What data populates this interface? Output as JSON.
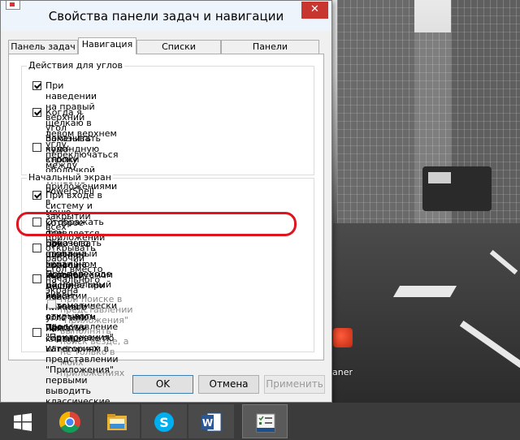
{
  "dialog": {
    "title": "Свойства панели задач и навигации",
    "close_glyph": "✕",
    "tabs": [
      "Панель задач",
      "Навигация",
      "Списки переходов",
      "Панели инструментов"
    ],
    "active_tab": "Навигация",
    "group_corners": {
      "title": "Действия для углов",
      "items": [
        {
          "label": "При наведении на правый верхний угол показывать\nчудо-кнопки",
          "checked": true
        },
        {
          "label": "Когда я щелкаю в левом верхнем углу, переключаться между\nпоследними приложениями",
          "checked": true
        },
        {
          "label": "Заменить командную строку оболочкой Windows PowerShell в\nменю, которое появляется при щелчке правой кнопкой мыши\nлевого нижнего угла или нажатии клавиш Windows+X",
          "checked": false
        }
      ]
    },
    "group_start": {
      "title": "Начальный экран",
      "items": [
        {
          "label": "При входе в систему и закрытии всех приложений открывать\nрабочий стол вместо начального экрана",
          "checked": true
        },
        {
          "label": "Отображать фон рабочего стола на начальном экране",
          "checked": false,
          "highlighted": true
        },
        {
          "label": "Показывать начальный экран на используемом дисплее при\nнажатии клавиши с логотипом Windows",
          "checked": false
        },
        {
          "label": "При переходе на начальный экран автоматически открывать\nпредставление \"Приложения\"",
          "checked": false
        },
        {
          "label": "При поиске в представлении \"Приложения\" выполнять\nпоиск везде, а не только в моих приложениях",
          "checked": false,
          "disabled": true
        },
        {
          "label": "При сортировке по категориям в представлении \"Приложения\"\nпервыми выводить классические приложения",
          "checked": false
        }
      ]
    },
    "buttons": {
      "ok": "OK",
      "cancel": "Отмена",
      "apply": "Применить"
    }
  },
  "desktop": {
    "icon_label": "aner"
  },
  "taskbar": {
    "items": [
      "start-icon",
      "chrome-icon",
      "file-explorer-icon",
      "skype-icon",
      "word-icon",
      "taskbar-properties-icon"
    ]
  }
}
